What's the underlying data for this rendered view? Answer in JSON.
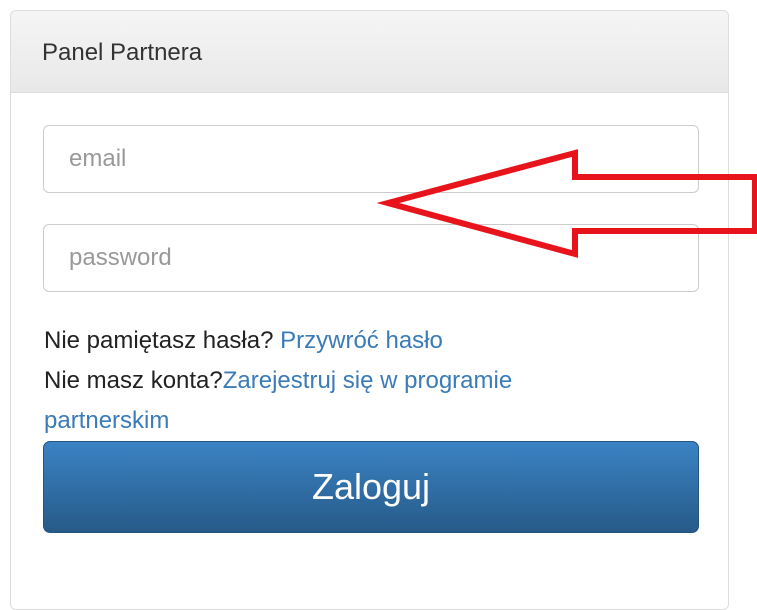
{
  "panel": {
    "title": "Panel Partnera"
  },
  "form": {
    "email_placeholder": "email",
    "password_placeholder": "password",
    "forgot_prompt": "Nie pamiętasz hasła? ",
    "forgot_link": "Przywróć hasło",
    "register_prompt": "Nie masz konta?",
    "register_link_part1": "Zarejestruj się w programie",
    "register_link_part2": "partnerskim",
    "login_label": "Zaloguj"
  },
  "colors": {
    "arrow": "#e8141c",
    "link": "#3a7bb8",
    "button": "#2e6da4"
  },
  "icons": {
    "annotation": "red-arrow-icon"
  }
}
